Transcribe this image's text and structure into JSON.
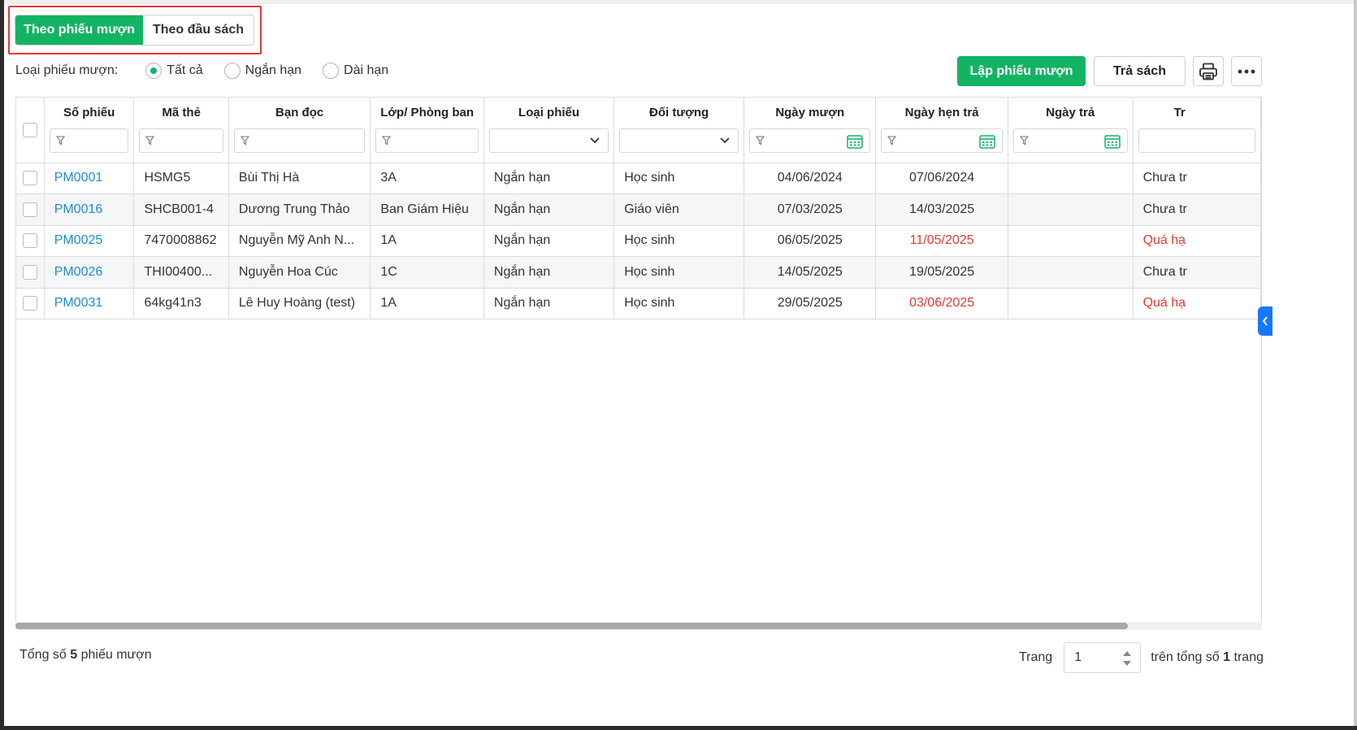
{
  "tabs": {
    "active": "Theo phiếu mượn",
    "inactive": "Theo đầu sách"
  },
  "filter": {
    "label": "Loại phiếu mượn:",
    "options": [
      "Tất cả",
      "Ngắn hạn",
      "Dài hạn"
    ],
    "selected": "Tất cả"
  },
  "toolbar": {
    "create_label": "Lập phiếu mượn",
    "return_label": "Trả sách",
    "print_icon": "printer-icon",
    "more_icon": "more-horizontal-icon"
  },
  "table": {
    "columns": [
      "Số phiếu",
      "Mã thẻ",
      "Bạn đọc",
      "Lớp/ Phòng ban",
      "Loại phiếu",
      "Đối tượng",
      "Ngày mượn",
      "Ngày hẹn trả",
      "Ngày trả",
      "Tr"
    ],
    "rows": [
      {
        "so_phieu": "PM0001",
        "ma_the": "HSMG5",
        "ban_doc": "Bùi Thị Hà",
        "lop": "3A",
        "loai": "Ngắn hạn",
        "doi_tuong": "Học sinh",
        "ngay_muon": "04/06/2024",
        "ngay_hen_tra": "07/06/2024",
        "ngay_tra": "",
        "trang_thai": "Chưa tr",
        "overdue": false
      },
      {
        "so_phieu": "PM0016",
        "ma_the": "SHCB001-4",
        "ban_doc": "Dương Trung Thảo",
        "lop": "Ban Giám Hiệu",
        "loai": "Ngắn hạn",
        "doi_tuong": "Giáo viên",
        "ngay_muon": "07/03/2025",
        "ngay_hen_tra": "14/03/2025",
        "ngay_tra": "",
        "trang_thai": "Chưa tr",
        "overdue": false
      },
      {
        "so_phieu": "PM0025",
        "ma_the": "7470008862",
        "ban_doc": "Nguyễn Mỹ Anh N...",
        "lop": "1A",
        "loai": "Ngắn hạn",
        "doi_tuong": "Học sinh",
        "ngay_muon": "06/05/2025",
        "ngay_hen_tra": "11/05/2025",
        "ngay_tra": "",
        "trang_thai": "Quá hạ",
        "overdue": true
      },
      {
        "so_phieu": "PM0026",
        "ma_the": "THI00400...",
        "ban_doc": "Nguyễn Hoa Cúc",
        "lop": "1C",
        "loai": "Ngắn hạn",
        "doi_tuong": "Học sinh",
        "ngay_muon": "14/05/2025",
        "ngay_hen_tra": "19/05/2025",
        "ngay_tra": "",
        "trang_thai": "Chưa tr",
        "overdue": false
      },
      {
        "so_phieu": "PM0031",
        "ma_the": "64kg41n3",
        "ban_doc": "Lê Huy Hoàng (test)",
        "lop": "1A",
        "loai": "Ngắn hạn",
        "doi_tuong": "Học sinh",
        "ngay_muon": "29/05/2025",
        "ngay_hen_tra": "03/06/2025",
        "ngay_tra": "",
        "trang_thai": "Quá hạ",
        "overdue": true
      }
    ]
  },
  "footer": {
    "total_prefix": "Tổng số",
    "total_count": "5",
    "total_suffix": "phiếu mượn",
    "page_label": "Trang",
    "page_value": "1",
    "page_total_prefix": "trên tổng số",
    "page_total": "1",
    "page_total_suffix": "trang"
  },
  "colors": {
    "primary": "#12b464",
    "link": "#1a8fd0",
    "overdue": "#e53935",
    "highlight_border": "#e53935",
    "side_toggle": "#1677ff"
  }
}
